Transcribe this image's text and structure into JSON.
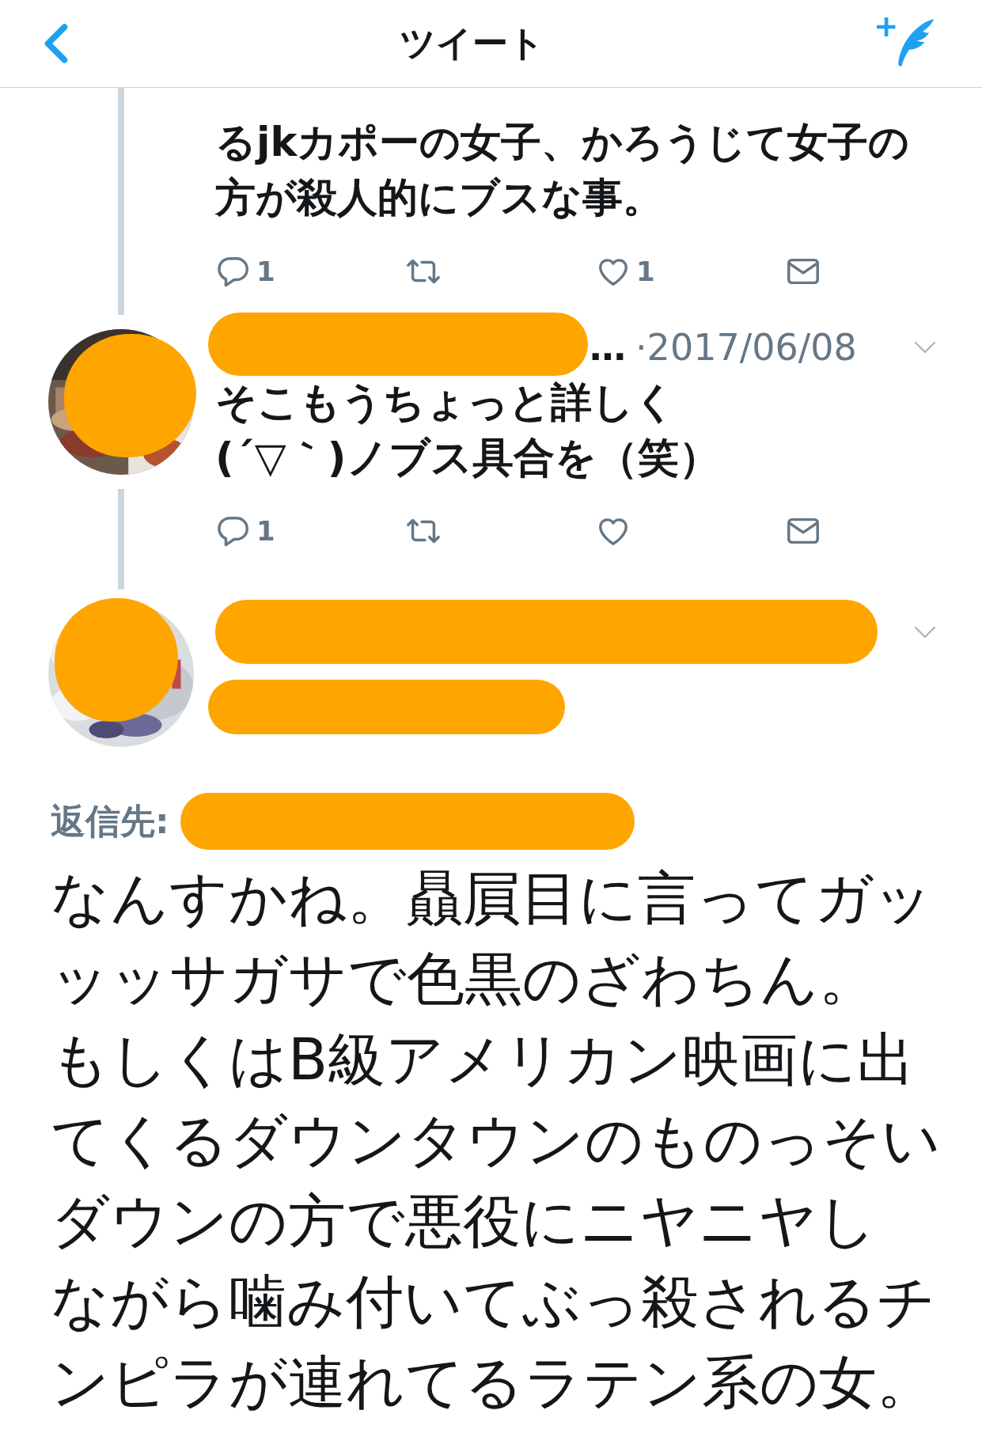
{
  "header": {
    "title": "ツイート"
  },
  "tweets": [
    {
      "kind": "parent",
      "text_lines": [
        "るjkカポーの女子、かろうじて女子の",
        "方が殺人的にブスな事。"
      ],
      "actions": [
        {
          "kind": "reply",
          "count": "1"
        },
        {
          "kind": "retweet"
        },
        {
          "kind": "like",
          "count": "1"
        },
        {
          "kind": "message"
        }
      ]
    },
    {
      "kind": "parent",
      "avatar": {
        "redacted": true
      },
      "author": {
        "redacted": true,
        "tail": "…"
      },
      "date": "·2017/06/08",
      "text_lines": [
        "そこもうちょっと詳しく",
        "(´▽｀)ノブス具合を（笑）"
      ],
      "actions": [
        {
          "kind": "reply",
          "count": "1"
        },
        {
          "kind": "retweet"
        },
        {
          "kind": "like"
        },
        {
          "kind": "message"
        }
      ]
    },
    {
      "kind": "focused",
      "avatar": {
        "redacted": true
      },
      "author": {
        "redacted": true
      },
      "handle": {
        "redacted": true
      },
      "reply_to": {
        "label": "返信先:",
        "redacted": true
      },
      "body_lines": [
        "なんすかね。贔屓目に言ってガッ",
        "ッッサガサで色黒のざわちん。",
        "もしくはB級アメリカン映画に出",
        "てくるダウンタウンのものっそい",
        "ダウンの方で悪役にニヤニヤし",
        "ながら噛み付いてぶっ殺されるチ",
        "ンピラが連れてるラテン系の女。"
      ]
    }
  ]
}
